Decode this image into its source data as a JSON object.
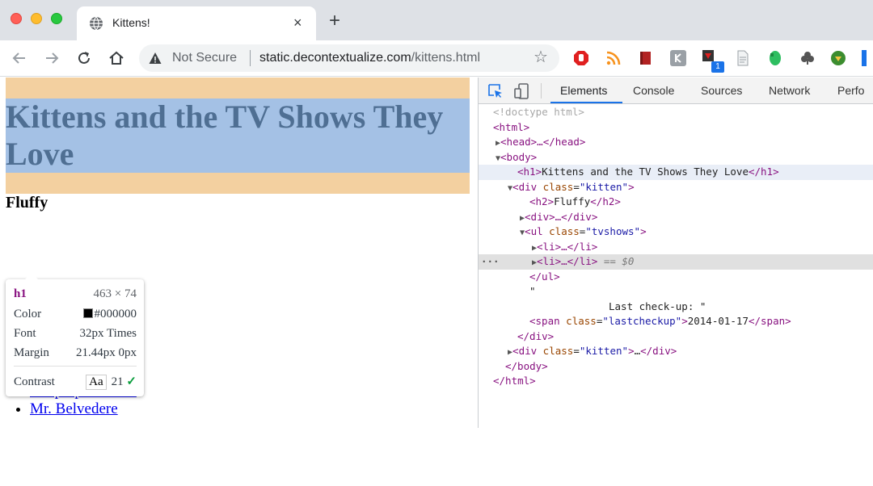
{
  "browser": {
    "tab_title": "Kittens!",
    "tab_close": "×",
    "new_tab": "+",
    "security_label": "Not Secure",
    "url_host": "static.decontextualize.com",
    "url_path": "/kittens.html",
    "bookmark_star": "☆",
    "extension_badge": "1"
  },
  "page": {
    "h1": "Kittens and the TV Shows They Love",
    "h2_partial": "Fluffy",
    "tv_shows": [
      "Deep Space Nine",
      "Mr. Belvedere"
    ]
  },
  "tooltip": {
    "tag": "h1",
    "dimensions": "463 × 74",
    "color_label": "Color",
    "color_value": "#000000",
    "font_label": "Font",
    "font_value": "32px Times",
    "margin_label": "Margin",
    "margin_value": "21.44px 0px",
    "contrast_label": "Contrast",
    "contrast_sample": "Aa",
    "contrast_value": "21",
    "contrast_check": "✓"
  },
  "devtools": {
    "tabs": [
      "Elements",
      "Console",
      "Sources",
      "Network",
      "Perfo"
    ],
    "active_tab": "Elements",
    "dom": {
      "doctype": "<!doctype html>",
      "html_open": "<html>",
      "head_collapsed": "<head>…</head>",
      "body_open": "<body>",
      "h1_open": "<h1>",
      "h1_text": "Kittens and the TV Shows They Love",
      "h1_close": "</h1>",
      "div_tag": "div",
      "class_attr": "class",
      "kitten_class": "\"kitten\"",
      "h2_open": "<h2>",
      "h2_text": "Fluffy",
      "h2_close": "</h2>",
      "div_collapsed": "<div>…</div>",
      "ul_tag": "ul",
      "tvshows_class": "\"tvshows\"",
      "li_collapsed": "<li>…</li>",
      "selected_marker": "== $0",
      "ul_close": "</ul>",
      "quote_open": "\"",
      "checkup_text": "Last check-up: \"",
      "span_tag": "span",
      "lastcheckup_class": "\"lastcheckup\"",
      "span_text": "2014-01-17",
      "span_close": "</span>",
      "div_close": "</div>",
      "body_close": "</body>",
      "html_close": "</html>",
      "ellipsis": "…"
    }
  },
  "colors": {
    "h1_margin": "#f3d0a0",
    "h1_content": "#a4c1e5",
    "devtools_tag": "#881280",
    "devtools_attr": "#994500",
    "devtools_value": "#1a1aa6",
    "active_tab_underline": "#1a73e8"
  },
  "icons": [
    "globe-icon",
    "close-icon",
    "back-icon",
    "forward-icon",
    "reload-icon",
    "home-icon",
    "warning-icon",
    "star-icon",
    "inspect-icon",
    "device-toggle-icon"
  ]
}
